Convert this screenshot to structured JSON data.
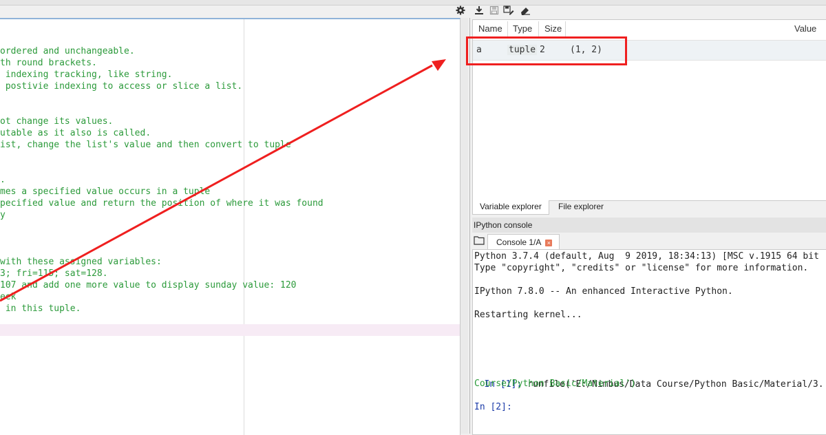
{
  "editor": {
    "lines": [
      "ordered and unchangeable.",
      "th round brackets.",
      " indexing tracking, like string.",
      " postivie indexing to access or slice a list.",
      "",
      "",
      "ot change its values.",
      "utable as it also is called.",
      "ist, change the list's value and then convert to tuple",
      "",
      "",
      ".",
      "mes a specified value occurs in a tuple",
      "pecified value and return the position of where it was found",
      "y",
      "",
      "",
      "",
      "with these assigned variables:",
      "3; fri=115; sat=128.",
      "107 and add one more value to display sunday value: 120",
      "eek",
      " in this tuple."
    ]
  },
  "toolbar": {
    "icons": [
      "gear-icon",
      "download-icon",
      "save-icon",
      "save-as-icon",
      "eraser-icon"
    ]
  },
  "variable_explorer": {
    "columns": [
      "Name",
      "Type",
      "Size",
      "Value"
    ],
    "rows": [
      {
        "name": "a",
        "type": "tuple",
        "size": "2",
        "value": "(1, 2)"
      }
    ],
    "tabs": [
      "Variable explorer",
      "File explorer"
    ]
  },
  "console": {
    "header": "IPython console",
    "tab_label": "Console 1/A",
    "lines": [
      {
        "text": "Python 3.7.4 (default, Aug  9 2019, 18:34:13) [MSC v.1915 64 bit",
        "style": "normal"
      },
      {
        "text": "Type \"copyright\", \"credits\" or \"license\" for more information.",
        "style": "normal"
      },
      {
        "text": "",
        "style": "normal"
      },
      {
        "text": "IPython 7.8.0 -- An enhanced Interactive Python.",
        "style": "normal"
      },
      {
        "text": "",
        "style": "normal"
      },
      {
        "text": "Restarting kernel...",
        "style": "normal"
      }
    ],
    "in1_prompt": "In [1]: ",
    "in1_code": "runfile('E:/Nimbus/Data Course/Python Basic/Material/3.",
    "in1_code_cont": "Course/Python Basic/Material')",
    "in2_prompt": "In [2]:"
  },
  "annotation": {
    "color": "#ef1f1f"
  }
}
